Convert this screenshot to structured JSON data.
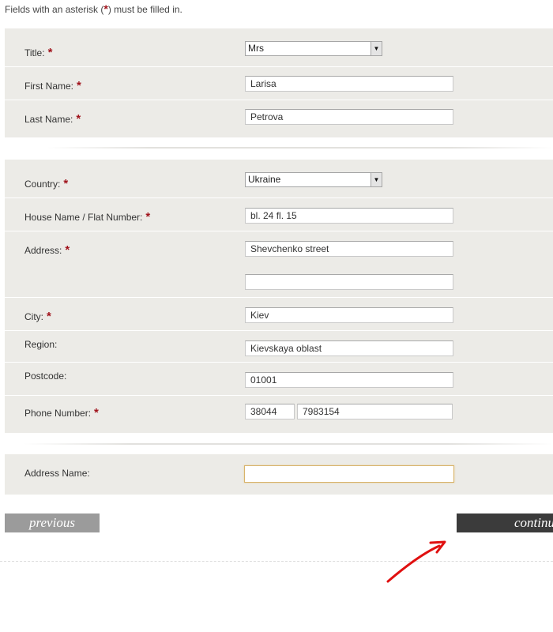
{
  "note": {
    "prefix": "Fields with an asterisk (",
    "asterisk": "*",
    "suffix": ") must be filled in."
  },
  "required_mark": "*",
  "personal": {
    "title": {
      "label": "Title:",
      "value": "Mrs"
    },
    "first_name": {
      "label": "First Name:",
      "value": "Larisa"
    },
    "last_name": {
      "label": "Last Name:",
      "value": "Petrova"
    }
  },
  "address": {
    "country": {
      "label": "Country:",
      "value": "Ukraine"
    },
    "house": {
      "label": "House Name / Flat Number:",
      "value": "bl. 24 fl. 15"
    },
    "address1": {
      "label": "Address:",
      "value": "Shevchenko street"
    },
    "address2": {
      "value": ""
    },
    "city": {
      "label": "City:",
      "value": "Kiev"
    },
    "region": {
      "label": "Region:",
      "value": "Kievskaya oblast"
    },
    "postcode": {
      "label": "Postcode:",
      "value": "01001"
    },
    "phone": {
      "label": "Phone Number:",
      "code": "38044",
      "number": "7983154"
    }
  },
  "address_name": {
    "label": "Address Name:",
    "value": ""
  },
  "buttons": {
    "previous": "previous",
    "continue": "continue"
  },
  "colors": {
    "required": "#a0131c",
    "panel": "#ecebe7",
    "previous_button": "#9b9b9b",
    "continue_button": "#3b3b3b",
    "annotation_arrow": "#e01010"
  },
  "icons": {
    "select_arrow": "triangle-down-icon",
    "annotation": "red-arrow-icon"
  }
}
